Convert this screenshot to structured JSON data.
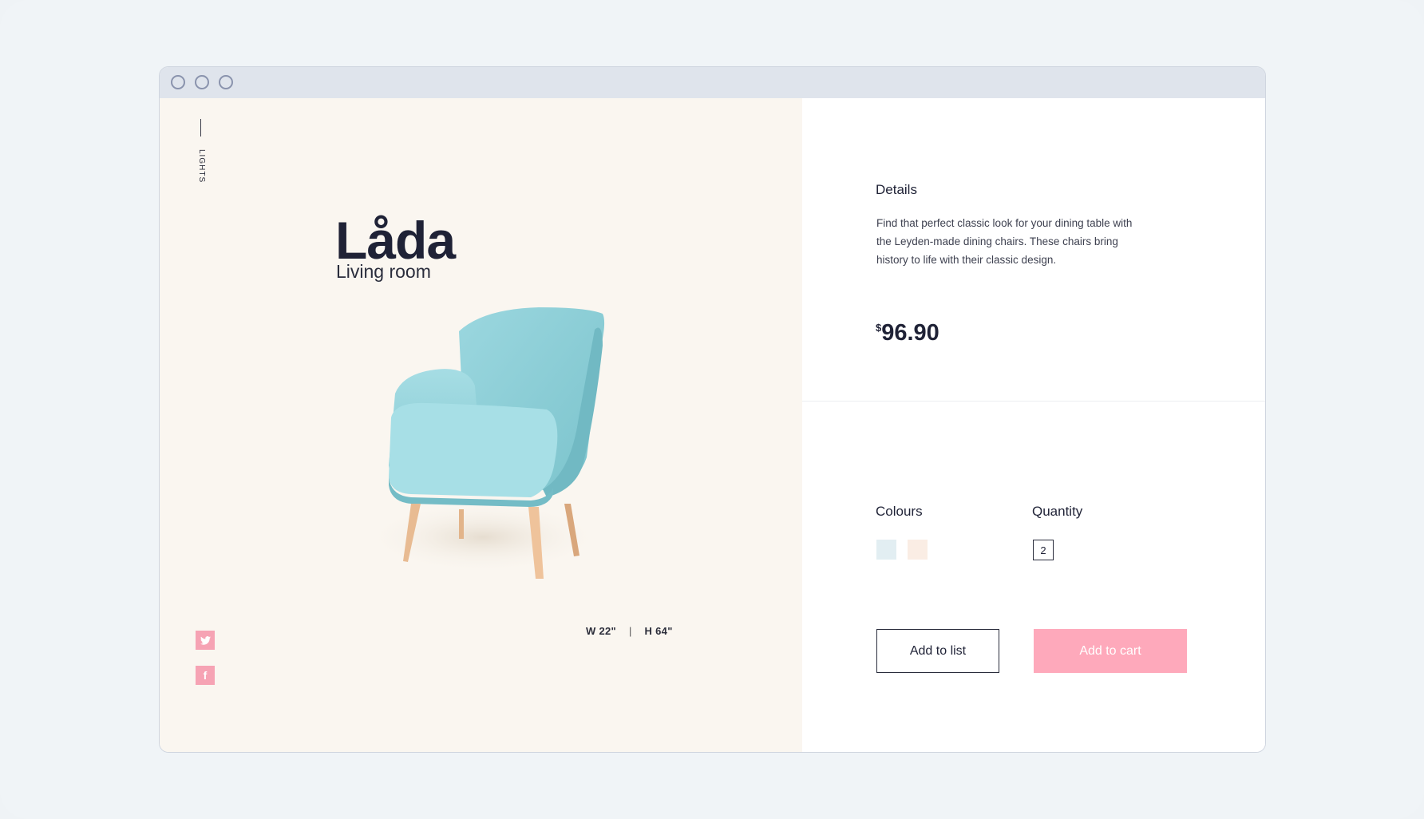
{
  "window": {
    "buttons": [
      "close",
      "minimize",
      "maximize"
    ]
  },
  "left_panel": {
    "vertical_label": "LIGHTS",
    "product_title": "Låda",
    "product_subtitle": "Living room",
    "dimensions": {
      "width": "W 22\"",
      "separator": "|",
      "height": "H 64\""
    },
    "social": [
      {
        "icon": "twitter-icon",
        "glyph": "🐦"
      },
      {
        "icon": "facebook-icon",
        "glyph": "f"
      }
    ]
  },
  "right_panel": {
    "details_heading": "Details",
    "description": "Find that perfect classic look for your dining table with the Leyden-made dining chairs. These chairs bring history to life with their classic design.",
    "price": {
      "currency": "$",
      "amount": "96.90"
    },
    "colours_heading": "Colours",
    "colours": [
      "#e2eef2",
      "#faede4"
    ],
    "quantity_heading": "Quantity",
    "quantity_value": "2",
    "add_to_list": "Add to list",
    "add_to_cart": "Add to cart"
  },
  "colors": {
    "accent_pink": "#fea9bb",
    "chair_blue": "#8fd0d8",
    "left_bg": "#faf6f0",
    "titlebar": "#dfe4ec"
  }
}
